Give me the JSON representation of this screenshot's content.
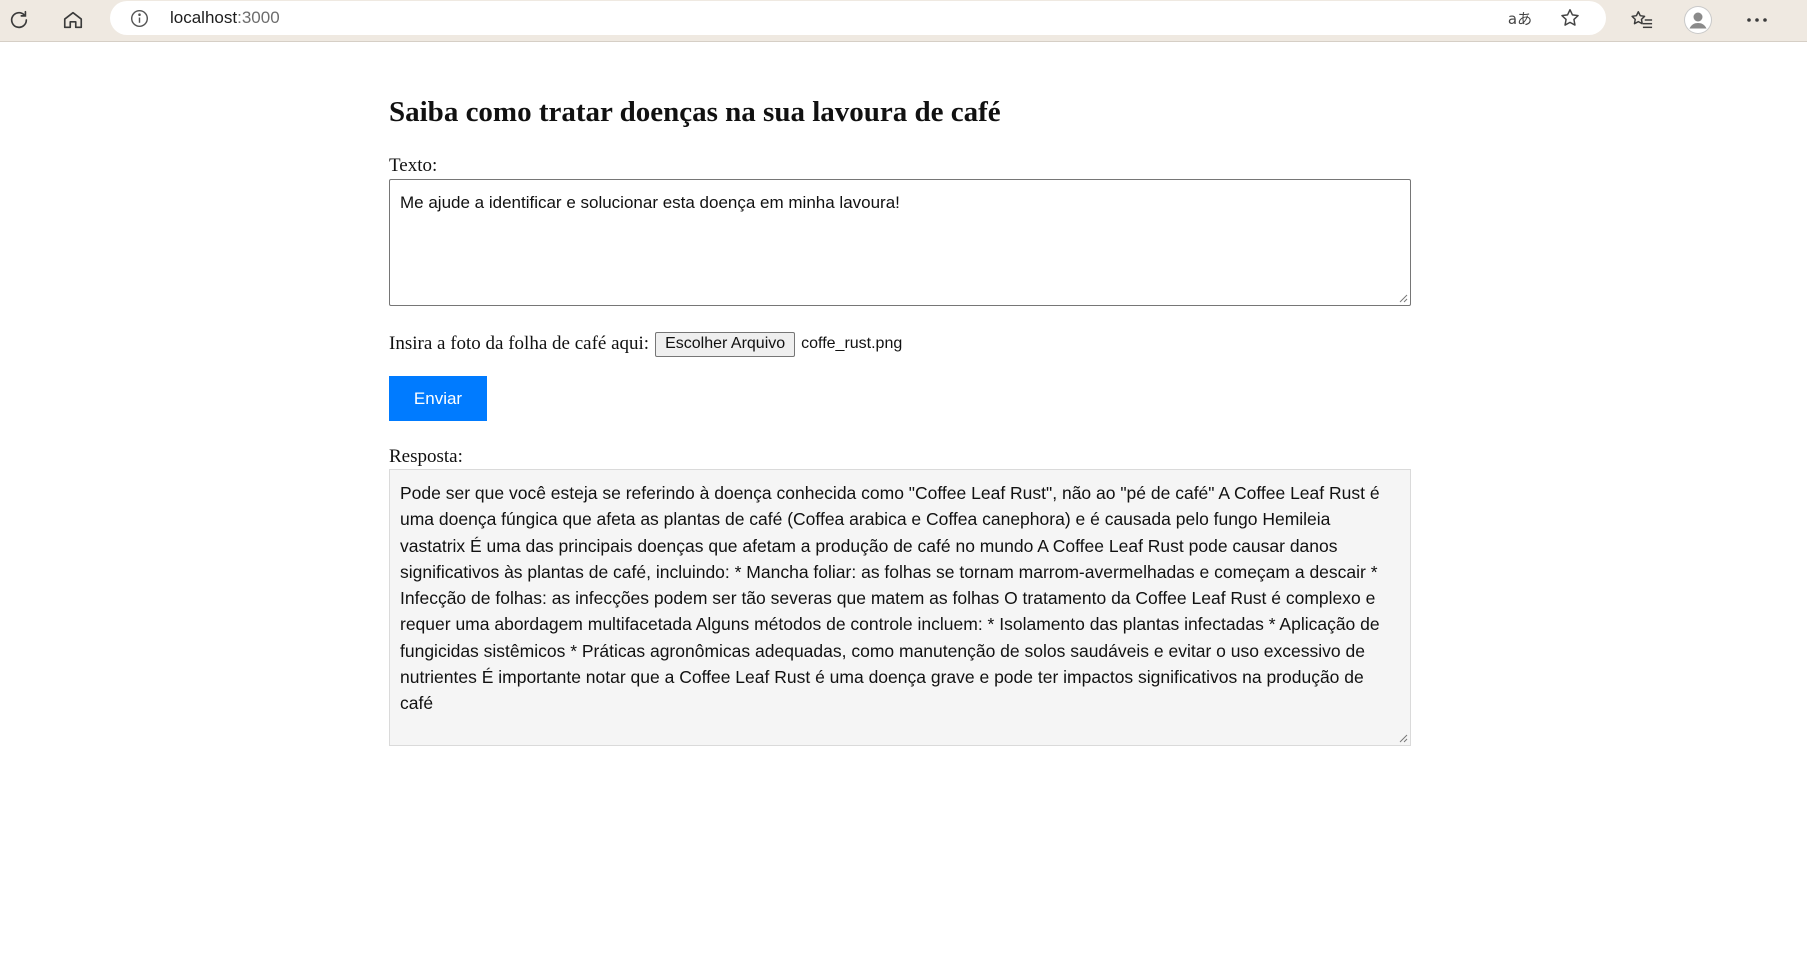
{
  "browser": {
    "url_host": "localhost",
    "url_port": ":3000",
    "translate_glyph": "aあ"
  },
  "page": {
    "title": "Saiba como tratar doenças na sua lavoura de café",
    "text_label": "Texto:",
    "text_value": "Me ajude a identificar e solucionar esta doença em minha lavoura!",
    "file_label": "Insira a foto da folha de café aqui:",
    "file_button": "Escolher Arquivo",
    "file_name": "coffe_rust.png",
    "send_button": "Enviar",
    "response_label": "Resposta:",
    "response_text": "Pode ser que você esteja se referindo à doença conhecida como \"Coffee Leaf Rust\", não ao \"pé de café\" A Coffee Leaf Rust é uma doença fúngica que afeta as plantas de café (Coffea arabica e Coffea canephora) e é causada pelo fungo Hemileia vastatrix É uma das principais doenças que afetam a produção de café no mundo  A Coffee Leaf Rust pode causar danos significativos às plantas de café, incluindo:  * Mancha foliar: as folhas se tornam marrom-avermelhadas e começam a descair * Infecção de folhas: as infecções podem ser tão severas que matem as folhas  O tratamento da Coffee Leaf Rust é complexo e requer uma abordagem multifacetada Alguns métodos de controle incluem:  * Isolamento das plantas infectadas * Aplicação de fungicidas sistêmicos * Práticas agronômicas adequadas, como manutenção de solos saudáveis e evitar o uso excessivo de nutrientes  É importante notar que a Coffee Leaf Rust é uma doença grave e pode ter impactos significativos na produção de café"
  },
  "colors": {
    "send_button_bg": "#007bff",
    "response_bg": "#f5f5f5",
    "chrome_bg": "#efe9e1"
  },
  "icons": [
    "reload-icon",
    "home-icon",
    "info-icon",
    "translate-icon",
    "star-icon",
    "favorites-icon",
    "profile-icon",
    "more-icon"
  ]
}
